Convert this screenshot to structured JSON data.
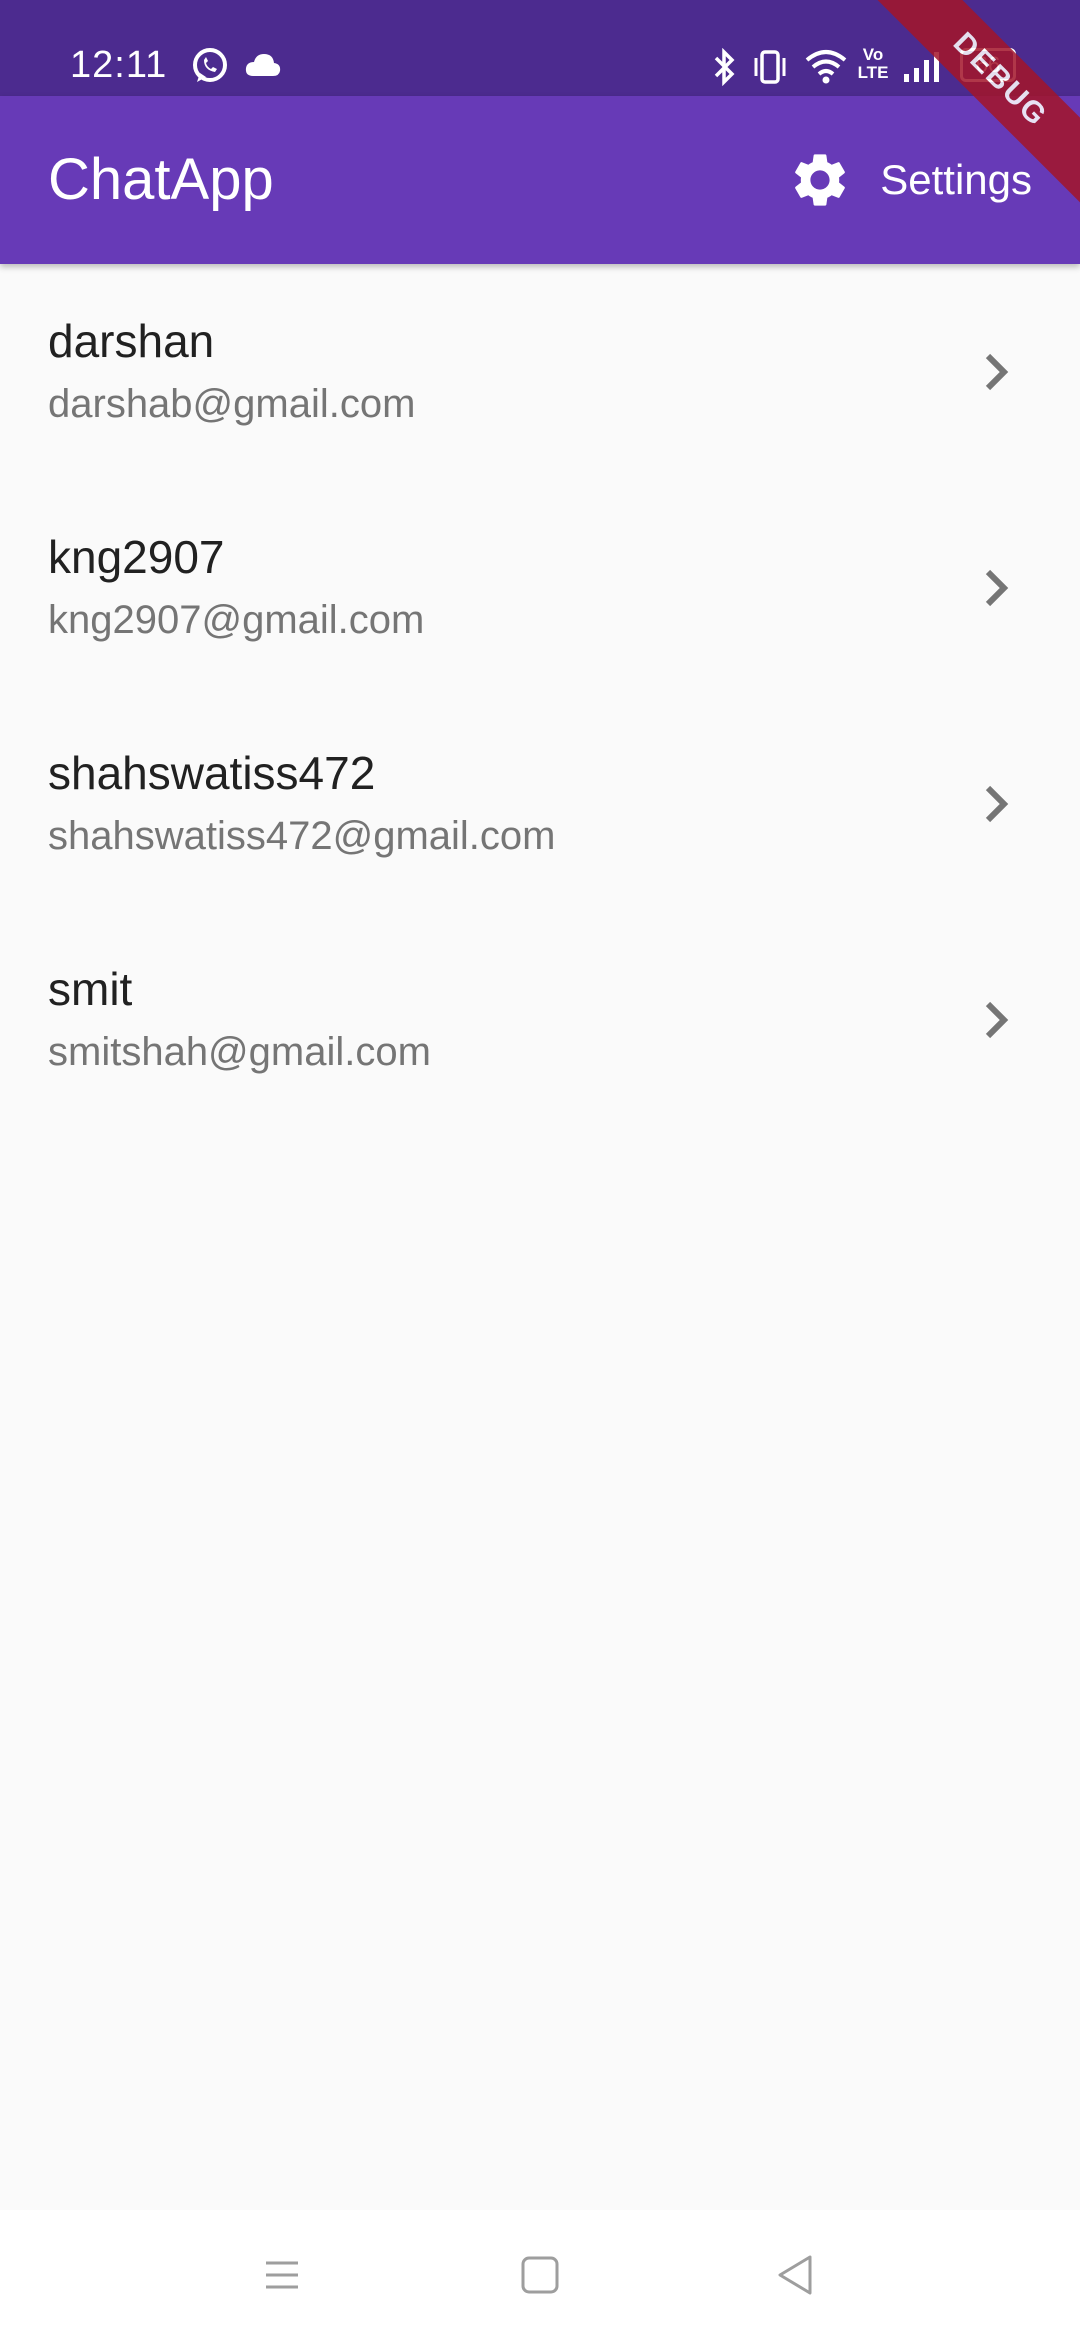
{
  "status_bar": {
    "time": "12:11",
    "battery": "66",
    "icons_left": [
      "whatsapp-icon",
      "cloud-icon"
    ],
    "icons_right": [
      "bluetooth-icon",
      "vibrate-icon",
      "wifi-icon",
      "volte-icon",
      "signal-icon",
      "battery-icon"
    ],
    "volte_label": "Vo LTE"
  },
  "app_bar": {
    "title": "ChatApp",
    "settings_label": "Settings",
    "settings_icon": "gear-icon",
    "color": "#673ab7"
  },
  "debug_banner": "DEBUG",
  "contacts": [
    {
      "name": "darshan",
      "email": "darshab@gmail.com"
    },
    {
      "name": "kng2907",
      "email": "kng2907@gmail.com"
    },
    {
      "name": "shahswatiss472",
      "email": "shahswatiss472@gmail.com"
    },
    {
      "name": "smit",
      "email": "smitshah@gmail.com"
    }
  ],
  "nav_bar": {
    "buttons": [
      "menu-icon",
      "home-icon",
      "back-icon"
    ]
  },
  "colors": {
    "status_bar": "#4c2b8f",
    "app_bar": "#673ab7",
    "background": "#fafafa",
    "primary_text": "#212121",
    "secondary_text": "#757575",
    "debug": "#a3152a"
  }
}
